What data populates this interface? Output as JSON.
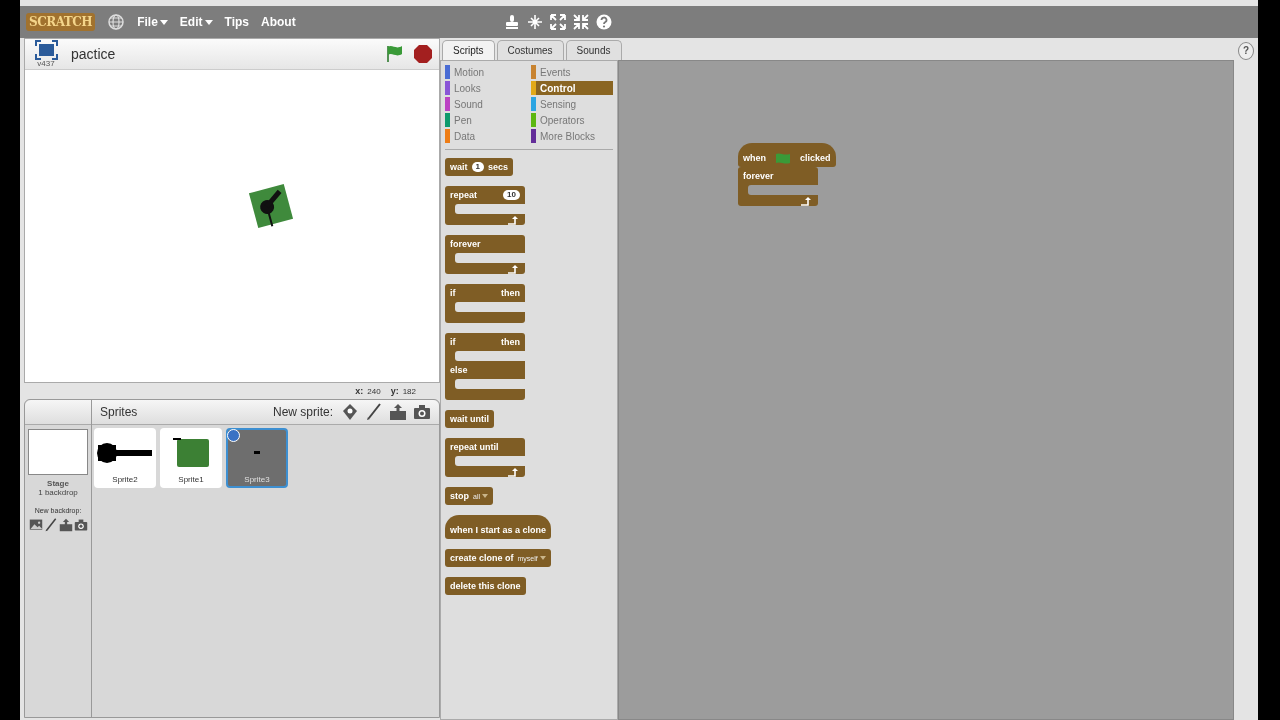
{
  "menu_bar": {
    "logo": "SCRATCH",
    "menus": [
      {
        "label": "File",
        "dropdown": true
      },
      {
        "label": "Edit",
        "dropdown": true
      },
      {
        "label": "Tips",
        "dropdown": false
      },
      {
        "label": "About",
        "dropdown": false
      }
    ]
  },
  "stage": {
    "title": "pactice",
    "version": "v437",
    "x_label": "x:",
    "x_value": "240",
    "y_label": "y:",
    "y_value": "182"
  },
  "sprites_panel": {
    "title": "Sprites",
    "new_sprite_label": "New sprite:",
    "stage_name": "Stage",
    "backdrop_count": "1 backdrop",
    "new_backdrop_label": "New backdrop:",
    "sprites": [
      {
        "name": "Sprite2",
        "kind": "cannon",
        "selected": false
      },
      {
        "name": "Sprite1",
        "kind": "square",
        "selected": false
      },
      {
        "name": "Sprite3",
        "kind": "dot",
        "selected": true
      }
    ]
  },
  "tabs": [
    {
      "label": "Scripts",
      "selected": true
    },
    {
      "label": "Costumes",
      "selected": false
    },
    {
      "label": "Sounds",
      "selected": false
    }
  ],
  "categories": [
    {
      "label": "Motion",
      "color": "#4a6cd4",
      "selected": false
    },
    {
      "label": "Events",
      "color": "#c88330",
      "selected": false
    },
    {
      "label": "Looks",
      "color": "#8a55d7",
      "selected": false
    },
    {
      "label": "Control",
      "color": "#e1a91a",
      "selected": true
    },
    {
      "label": "Sound",
      "color": "#bb42c3",
      "selected": false
    },
    {
      "label": "Sensing",
      "color": "#2ca5e2",
      "selected": false
    },
    {
      "label": "Pen",
      "color": "#0e9a6c",
      "selected": false
    },
    {
      "label": "Operators",
      "color": "#5cb712",
      "selected": false
    },
    {
      "label": "Data",
      "color": "#ee7d16",
      "selected": false
    },
    {
      "label": "More Blocks",
      "color": "#632d99",
      "selected": false
    }
  ],
  "palette_blocks": [
    {
      "kind": "command",
      "parts": [
        {
          "kind": "label",
          "text": "wait"
        },
        {
          "kind": "number",
          "text": "1"
        },
        {
          "kind": "label",
          "text": "secs"
        }
      ]
    },
    {
      "kind": "loop",
      "parts": [
        {
          "kind": "label",
          "text": "repeat"
        },
        {
          "kind": "number",
          "text": "10"
        }
      ]
    },
    {
      "kind": "loop",
      "parts": [
        {
          "kind": "label",
          "text": "forever"
        }
      ]
    },
    {
      "kind": "if",
      "parts": [
        {
          "kind": "label",
          "text": "if"
        },
        {
          "kind": "label",
          "text": "then"
        }
      ]
    },
    {
      "kind": "ifelse",
      "parts": [
        {
          "kind": "label",
          "text": "if"
        },
        {
          "kind": "label",
          "text": "then"
        }
      ],
      "else_label": "else"
    },
    {
      "kind": "command",
      "parts": [
        {
          "kind": "label",
          "text": "wait until"
        }
      ]
    },
    {
      "kind": "loop",
      "parts": [
        {
          "kind": "label",
          "text": "repeat until"
        }
      ]
    },
    {
      "kind": "command",
      "parts": [
        {
          "kind": "label",
          "text": "stop"
        },
        {
          "kind": "dropdown",
          "text": "all"
        }
      ]
    },
    {
      "kind": "hat",
      "parts": [
        {
          "kind": "label",
          "text": "when I start as a clone"
        }
      ]
    },
    {
      "kind": "command",
      "parts": [
        {
          "kind": "label",
          "text": "create clone of"
        },
        {
          "kind": "dropdown",
          "text": "myself"
        }
      ]
    },
    {
      "kind": "command",
      "parts": [
        {
          "kind": "label",
          "text": "delete this clone"
        }
      ]
    }
  ],
  "script_blocks": [
    {
      "kind": "hat",
      "parts": [
        {
          "kind": "label",
          "text": "when"
        },
        {
          "kind": "flag"
        },
        {
          "kind": "label",
          "text": "clicked"
        }
      ]
    },
    {
      "kind": "loop",
      "parts": [
        {
          "kind": "label",
          "text": "forever"
        }
      ]
    }
  ],
  "help_label": "?"
}
